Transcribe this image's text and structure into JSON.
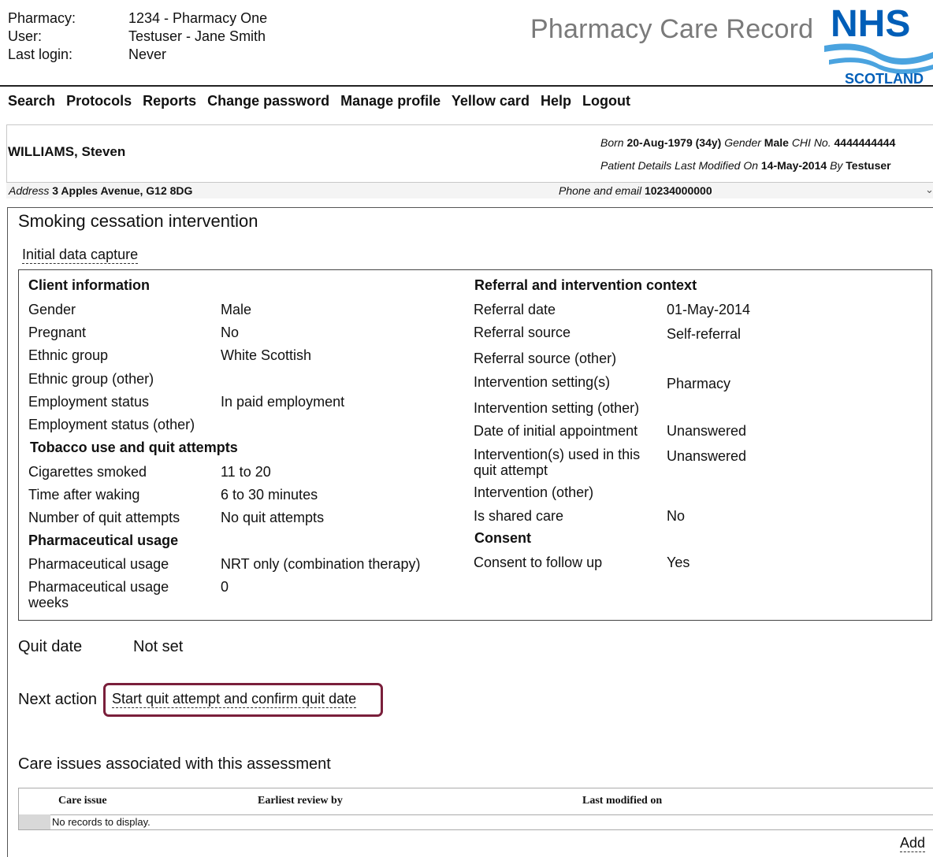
{
  "header": {
    "pharmacy_label": "Pharmacy:",
    "pharmacy_value": "1234 - Pharmacy One",
    "user_label": "User:",
    "user_value": "Testuser - Jane Smith",
    "login_label": "Last login:",
    "login_value": "Never",
    "app_title": "Pharmacy Care Record",
    "logo_nhs": "NHS",
    "logo_scotland": "SCOTLAND",
    "brand_color": "#005eb8"
  },
  "nav": [
    "Search",
    "Protocols",
    "Reports",
    "Change password",
    "Manage profile",
    "Yellow card",
    "Help",
    "Logout"
  ],
  "patient": {
    "name": "WILLIAMS, Steven",
    "born_label": "Born",
    "born": "20-Aug-1979",
    "age": "(34y)",
    "gender_label": "Gender",
    "gender": "Male",
    "chi_label": "CHI No.",
    "chi": "4444444444",
    "modified_label": "Patient Details Last Modified On",
    "modified_date": "14-May-2014",
    "by_label": "By",
    "by_user": "Testuser",
    "address_label": "Address",
    "address": "3 Apples Avenue, G12 8DG",
    "phone_label": "Phone and email",
    "phone": "10234000000",
    "expand_icon": "chevron-down-icon"
  },
  "page": {
    "title": "Smoking cessation intervention",
    "section_link": "Initial data capture"
  },
  "client": {
    "heading": "Client information",
    "rows": [
      {
        "label": "Gender",
        "value": "Male"
      },
      {
        "label": "Pregnant",
        "value": "No"
      },
      {
        "label": "Ethnic group",
        "value": "White Scottish"
      },
      {
        "label": "Ethnic group (other)",
        "value": ""
      },
      {
        "label": "Employment status",
        "value": "In paid employment"
      },
      {
        "label": "Employment status (other)",
        "value": ""
      }
    ],
    "tobacco_heading": "Tobacco use and quit attempts",
    "tobacco_rows": [
      {
        "label": "Cigarettes smoked",
        "value": "11 to 20"
      },
      {
        "label": "Time after waking",
        "value": "6 to 30 minutes"
      },
      {
        "label": "Number of quit attempts",
        "value": "No quit attempts"
      }
    ],
    "pharma_heading": "Pharmaceutical usage",
    "pharma_rows": [
      {
        "label": "Pharmaceutical usage",
        "value": "NRT only (combination therapy)"
      },
      {
        "label": "Pharmaceutical usage weeks",
        "value": "0"
      }
    ]
  },
  "referral": {
    "heading": "Referral and intervention context",
    "rows": [
      {
        "label": "Referral date",
        "value": "01-May-2014"
      },
      {
        "label": "Referral source",
        "value": "Self-referral"
      },
      {
        "label": "Referral source (other)",
        "value": ""
      },
      {
        "label": "Intervention setting(s)",
        "value": "Pharmacy"
      },
      {
        "label": "Intervention setting (other)",
        "value": ""
      },
      {
        "label": "Date of initial appointment",
        "value": "Unanswered"
      },
      {
        "label": "Intervention(s) used in this quit attempt",
        "value": "Unanswered"
      },
      {
        "label": "Intervention (other)",
        "value": ""
      },
      {
        "label": "Is shared care",
        "value": "No"
      }
    ],
    "consent_heading": "Consent",
    "consent_rows": [
      {
        "label": "Consent to follow up",
        "value": "Yes"
      }
    ]
  },
  "quit": {
    "label": "Quit date",
    "value": "Not set"
  },
  "next_action": {
    "label": "Next action",
    "link": "Start quit attempt and confirm quit date"
  },
  "care_issues": {
    "title": "Care issues associated with this assessment",
    "columns": [
      "Care issue",
      "Earliest review by",
      "Last modified on"
    ],
    "empty_text": "No records to display.",
    "add_label": "Add"
  }
}
